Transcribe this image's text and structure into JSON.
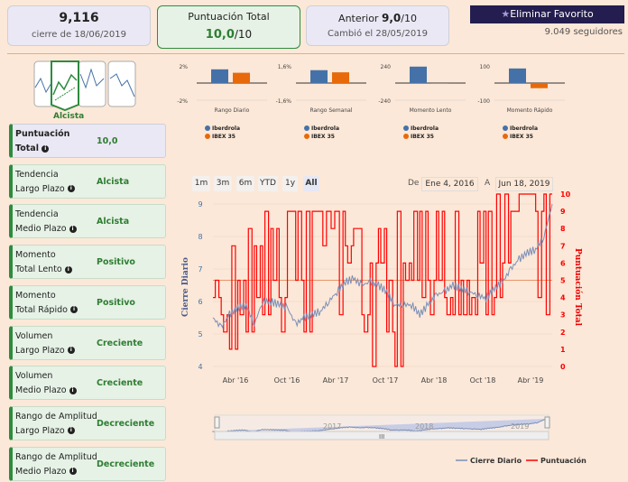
{
  "header": {
    "price": "9,116",
    "price_sub": "cierre de 18/06/2019",
    "score_title": "Puntuación Total",
    "score_value": "10,0",
    "score_suffix": "/10",
    "prev_label": "Anterior",
    "prev_value": "9,0",
    "prev_suffix": "/10",
    "prev_sub": "Cambió el 28/05/2019",
    "fav_button": "Eliminar Favorito",
    "followers": "9.049 seguidores"
  },
  "trend_icon_label": "Alcista",
  "side": [
    {
      "l1": "Puntuación",
      "l2": "Total",
      "v": "10,0"
    },
    {
      "l1": "Tendencia",
      "l2": "Largo Plazo",
      "v": "Alcista"
    },
    {
      "l1": "Tendencia",
      "l2": "Medio Plazo",
      "v": "Alcista"
    },
    {
      "l1": "Momento",
      "l2": "Total Lento",
      "v": "Positivo"
    },
    {
      "l1": "Momento",
      "l2": "Total Rápido",
      "v": "Positivo"
    },
    {
      "l1": "Volumen",
      "l2": "Largo Plazo",
      "v": "Creciente"
    },
    {
      "l1": "Volumen",
      "l2": "Medio Plazo",
      "v": "Creciente"
    },
    {
      "l1": "Rango de Amplitud",
      "l2": "Largo Plazo",
      "v": "Decreciente"
    },
    {
      "l1": "Rango de Amplitud",
      "l2": "Medio Plazo",
      "v": "Decreciente"
    }
  ],
  "mini_charts": [
    {
      "title": "Rango Diario",
      "top": "2%",
      "bottom": "-2%",
      "max": 2,
      "values": [
        1.6,
        1.2
      ]
    },
    {
      "title": "Rango Semanal",
      "top": "1,6%",
      "bottom": "-1,6%",
      "max": 1.6,
      "values": [
        1.2,
        1.0
      ]
    },
    {
      "title": "Momento Lento",
      "top": "240",
      "bottom": "-240",
      "max": 240,
      "values": [
        230,
        -5
      ]
    },
    {
      "title": "Momento Rápido",
      "top": "100",
      "bottom": "-100",
      "max": 100,
      "values": [
        85,
        -30
      ]
    }
  ],
  "mini_legend": [
    "Iberdrola",
    "IBEX 35"
  ],
  "colors": {
    "iberdrola": "#4472a8",
    "ibex": "#e8690a",
    "price": "#7b8fb8",
    "score": "#ff0000",
    "accent": "#241d4f",
    "green": "#2e7d32"
  },
  "range": {
    "buttons": [
      "1m",
      "3m",
      "6m",
      "YTD",
      "1y",
      "All"
    ],
    "from_label": "De",
    "from": "Ene 4, 2016",
    "to_label": "A",
    "to": "Jun 18, 2019"
  },
  "chart_data": {
    "type": "line",
    "ylabel_left": "Cierre Diario",
    "ylabel_right": "Puntuación Total",
    "yticks_left": [
      "4",
      "5",
      "6",
      "7",
      "8",
      "9"
    ],
    "ylim_left": [
      4,
      9
    ],
    "yticks_right": [
      "0",
      "1",
      "2",
      "3",
      "4",
      "5",
      "6",
      "7",
      "8",
      "9",
      "10"
    ],
    "ylim_right": [
      0,
      10
    ],
    "xticks": [
      "Abr '16",
      "Oct '16",
      "Abr '17",
      "Oct '17",
      "Abr '18",
      "Oct '18",
      "Abr '19"
    ],
    "navigator_labels": [
      "2017",
      "2018",
      "2019"
    ],
    "series": [
      {
        "name": "Cierre Diario",
        "values": [
          5.5,
          5.2,
          5.6,
          5.8,
          5.9,
          5.3,
          6.0,
          6.0,
          5.9,
          5.8,
          5.3,
          5.5,
          5.6,
          5.7,
          6.0,
          6.3,
          6.6,
          6.7,
          6.5,
          6.6,
          6.5,
          6.3,
          5.9,
          5.9,
          5.9,
          5.6,
          5.9,
          6.2,
          6.3,
          6.5,
          6.4,
          6.3,
          6.2,
          6.1,
          6.4,
          6.6,
          7.0,
          7.3,
          7.5,
          7.6,
          8.0,
          9.0
        ]
      },
      {
        "name": "Puntuación",
        "values": [
          4,
          3,
          1,
          5,
          2,
          7,
          3,
          8,
          4,
          9,
          5,
          2,
          9,
          9,
          9,
          9,
          7,
          8,
          3,
          6,
          8,
          2,
          0,
          6,
          5,
          9,
          5,
          9,
          4,
          3,
          5,
          3,
          9,
          3,
          4,
          6,
          9,
          10,
          10,
          9,
          10,
          10
        ]
      }
    ]
  }
}
